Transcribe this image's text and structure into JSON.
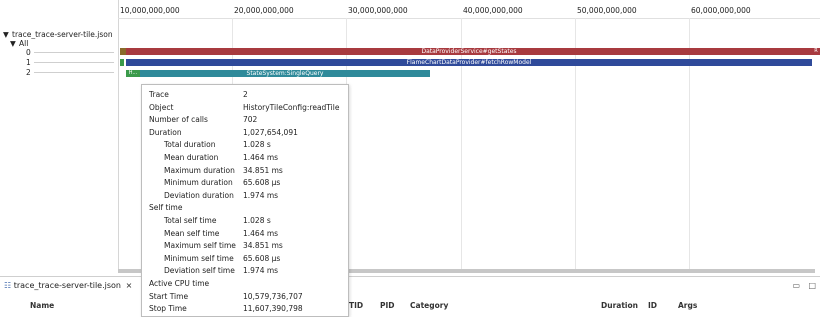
{
  "tree": {
    "root_label": "trace_trace-server-tile.json",
    "group_label": "All",
    "rows": [
      "0",
      "1",
      "2"
    ]
  },
  "axis": {
    "ticks": [
      "10,000,000,000",
      "20,000,000,000",
      "30,000,000,000",
      "40,000,000,000",
      "50,000,000,000",
      "60,000,000,000"
    ]
  },
  "bars": {
    "row0_label": "DataProviderService#getStates",
    "row0_end_label": "R",
    "row1_label": "FlameChartDataProvider#fetchRowModel",
    "row2_small_label": "H...",
    "row2_label": "StateSystem:SingleQuery"
  },
  "tooltip": {
    "rows": [
      {
        "label": "Trace",
        "value": "2",
        "indent": false
      },
      {
        "label": "Object",
        "value": "HistoryTileConfig:readTile",
        "indent": false
      },
      {
        "label": "Number of calls",
        "value": "702",
        "indent": false
      },
      {
        "label": "Duration",
        "value": "1,027,654,091",
        "indent": false
      },
      {
        "label": "Total duration",
        "value": "1.028 s",
        "indent": true
      },
      {
        "label": "Mean duration",
        "value": "1.464 ms",
        "indent": true
      },
      {
        "label": "Maximum duration",
        "value": "34.851 ms",
        "indent": true
      },
      {
        "label": "Minimum duration",
        "value": "65.608 µs",
        "indent": true
      },
      {
        "label": "Deviation duration",
        "value": "1.974 ms",
        "indent": true
      },
      {
        "label": "Self time",
        "value": "",
        "indent": false
      },
      {
        "label": "Total self time",
        "value": "1.028 s",
        "indent": true
      },
      {
        "label": "Mean self time",
        "value": "1.464 ms",
        "indent": true
      },
      {
        "label": "Maximum self time",
        "value": "34.851 ms",
        "indent": true
      },
      {
        "label": "Minimum self time",
        "value": "65.608 µs",
        "indent": true
      },
      {
        "label": "Deviation self time",
        "value": "1.974 ms",
        "indent": true
      },
      {
        "label": "Active CPU time",
        "value": "",
        "indent": false
      },
      {
        "label": "Start Time",
        "value": "10,579,736,707",
        "indent": false
      },
      {
        "label": "Stop Time",
        "value": "11,607,390,798",
        "indent": false
      }
    ]
  },
  "bottom_panel": {
    "tab_label": "trace_trace-server-tile.json",
    "tab_close": "×",
    "minimize": "▭",
    "columns": [
      "Name",
      "TID",
      "PID",
      "Category",
      "Duration",
      "ID",
      "Args"
    ]
  },
  "colors": {
    "row0": "#a83a3f",
    "row1": "#2f4a9a",
    "row2": "#2f8a9a",
    "small_green": "#3a9a4a"
  }
}
